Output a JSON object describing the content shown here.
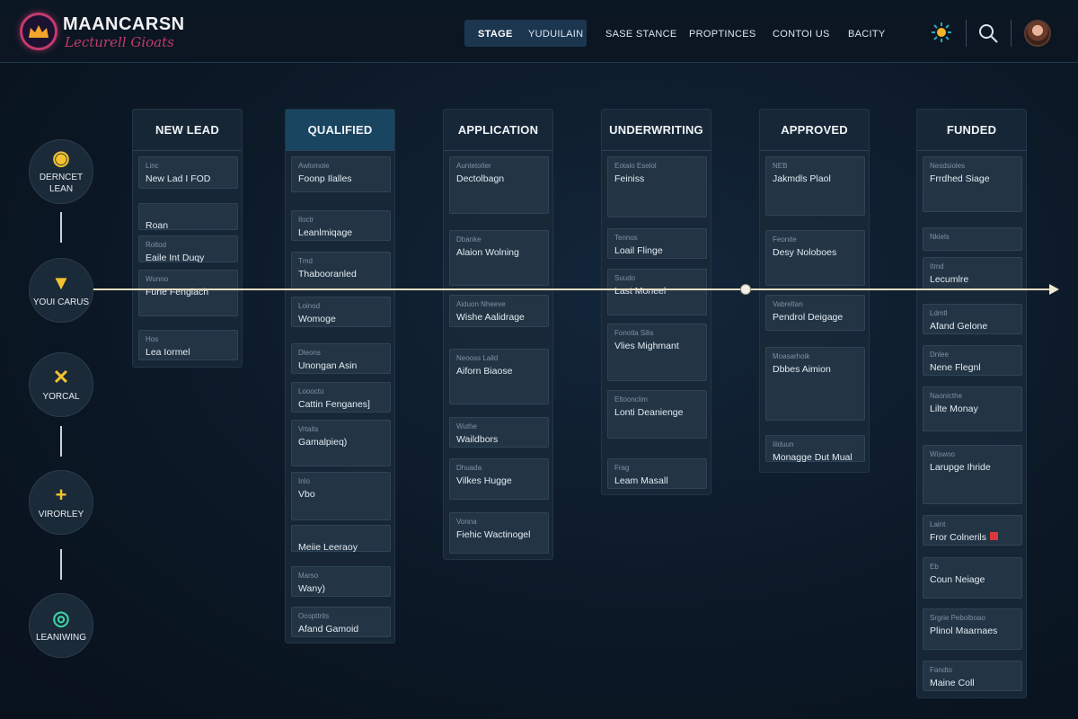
{
  "brand": {
    "title": "MAANCARSN",
    "subtitle": "Lecturell Gioats",
    "accent": "#c43a6b"
  },
  "nav": {
    "items": [
      "STAGE",
      "YUDUILAIN",
      "SASE STANCE",
      "PROPTINCES",
      "CONTOI US",
      "BACITY"
    ],
    "active": "STAGE"
  },
  "header_icons": [
    "sun-icon",
    "search-icon",
    "user-avatar"
  ],
  "rail": [
    {
      "label": "DERNCET LEAN",
      "icon": "location-icon",
      "glyph": "◉"
    },
    {
      "label": "YOUI CARUS",
      "icon": "triangle-down-icon",
      "glyph": "▼"
    },
    {
      "label": "YORCAL",
      "icon": "close-icon",
      "glyph": "✕"
    },
    {
      "label": "VIRORLEY",
      "icon": "plus-icon",
      "glyph": "+"
    },
    {
      "label": "LEANIWING",
      "icon": "target-icon",
      "glyph": "◎"
    }
  ],
  "columns": [
    {
      "title": "NEW LEAD",
      "cards": [
        {
          "meta": "Linc",
          "title": "New Lad I FOD"
        },
        {
          "meta": "",
          "title": "Roan",
          "icon_row": true
        },
        {
          "meta": "Roltod",
          "title": "Eaile Int Duqy"
        },
        {
          "meta": "Wunno",
          "title": "Fune Fengiach"
        },
        {
          "meta": "Hos",
          "title": "Lea Iormel"
        }
      ]
    },
    {
      "title": "QUALIFIED",
      "cards": [
        {
          "meta": "Awlomole",
          "title": "Foonp Ilalles"
        },
        {
          "meta": "Iloctr",
          "title": "Leanlmiqage"
        },
        {
          "meta": "Tmd",
          "title": "Thabooranled"
        },
        {
          "meta": "Loinod",
          "title": "Womoge"
        },
        {
          "meta": "Dleons",
          "title": "Unongan Asin"
        },
        {
          "meta": "Loooctu",
          "title": "Cattin Fenganes]"
        },
        {
          "meta": "Vrtaits",
          "title": "Gamalpieq)"
        },
        {
          "meta": "Inlo",
          "title": "Vbo"
        },
        {
          "meta": "",
          "title": "Meiie Leeraoy"
        },
        {
          "meta": "Marso",
          "title": "Wany)"
        },
        {
          "meta": "Ocopttrits",
          "title": "Afand Gamoid"
        }
      ]
    },
    {
      "title": "APPLICATION",
      "cards": [
        {
          "meta": "Auntetoiter",
          "title": "Dectolbagn"
        },
        {
          "meta": "Dbanke",
          "title": "Alaion Wolning"
        },
        {
          "meta": "Aiduon Nheeve",
          "title": "Wishe Aalidrage"
        },
        {
          "meta": "Neooss Laild",
          "title": "Aiforn Biaose"
        },
        {
          "meta": "Wuthe",
          "title": "Waildbors"
        },
        {
          "meta": "Dhuada",
          "title": "Vilkes Hugge"
        },
        {
          "meta": "Vonna",
          "title": "Fiehic Wactinogel"
        }
      ]
    },
    {
      "title": "UNDERWRITING",
      "cards": [
        {
          "meta": "Eotalo Eselol",
          "title": "Feiniss"
        },
        {
          "meta": "Tennos",
          "title": "Loail Flinge"
        },
        {
          "meta": "Suudo",
          "title": "Last Moneel"
        },
        {
          "meta": "Fonotla Silis",
          "title": "Vlies Mighmant"
        },
        {
          "meta": "Eltoonclim",
          "title": "Lonti Deanienge"
        },
        {
          "meta": "Frag",
          "title": "Leam Masall"
        }
      ]
    },
    {
      "title": "APPROVED",
      "cards": [
        {
          "meta": "NEB",
          "title": "Jakmdls Plaol"
        },
        {
          "meta": "Feonite",
          "title": "Desy Noloboes"
        },
        {
          "meta": "Vabreltan",
          "title": "Pendrol Deigage"
        },
        {
          "meta": "Moasarhoik",
          "title": "Dbbes Aimion"
        },
        {
          "meta": "Iiiduun",
          "title": "Monagge Dut Mual"
        }
      ]
    },
    {
      "title": "FUNDED",
      "cards": [
        {
          "meta": "Nesdsioles",
          "title": "Frrdhed Siage"
        },
        {
          "meta": "Nkiels",
          "title": ""
        },
        {
          "meta": "Itmd",
          "title": "Lecumlre"
        },
        {
          "meta": "Ldmtl",
          "title": "Afand Gelone"
        },
        {
          "meta": "Dnlee",
          "title": "Nene Flegnl"
        },
        {
          "meta": "Naonicthe",
          "title": "Lilte Monay"
        },
        {
          "meta": "Wiswoo",
          "title": "Larupge Ihride"
        },
        {
          "meta": "Laint",
          "title": "Fror Colnerils",
          "flag": true
        },
        {
          "meta": "Eb",
          "title": "Coun Neiage"
        },
        {
          "meta": "Srgrie Pebolboao",
          "title": "Plinol Maarnaes"
        },
        {
          "meta": "Fandto",
          "title": "Maine Coll"
        }
      ]
    }
  ],
  "colors": {
    "background": "#0c1826",
    "rail_accent": "#f2c230",
    "timeline": "#e8ddc0"
  }
}
